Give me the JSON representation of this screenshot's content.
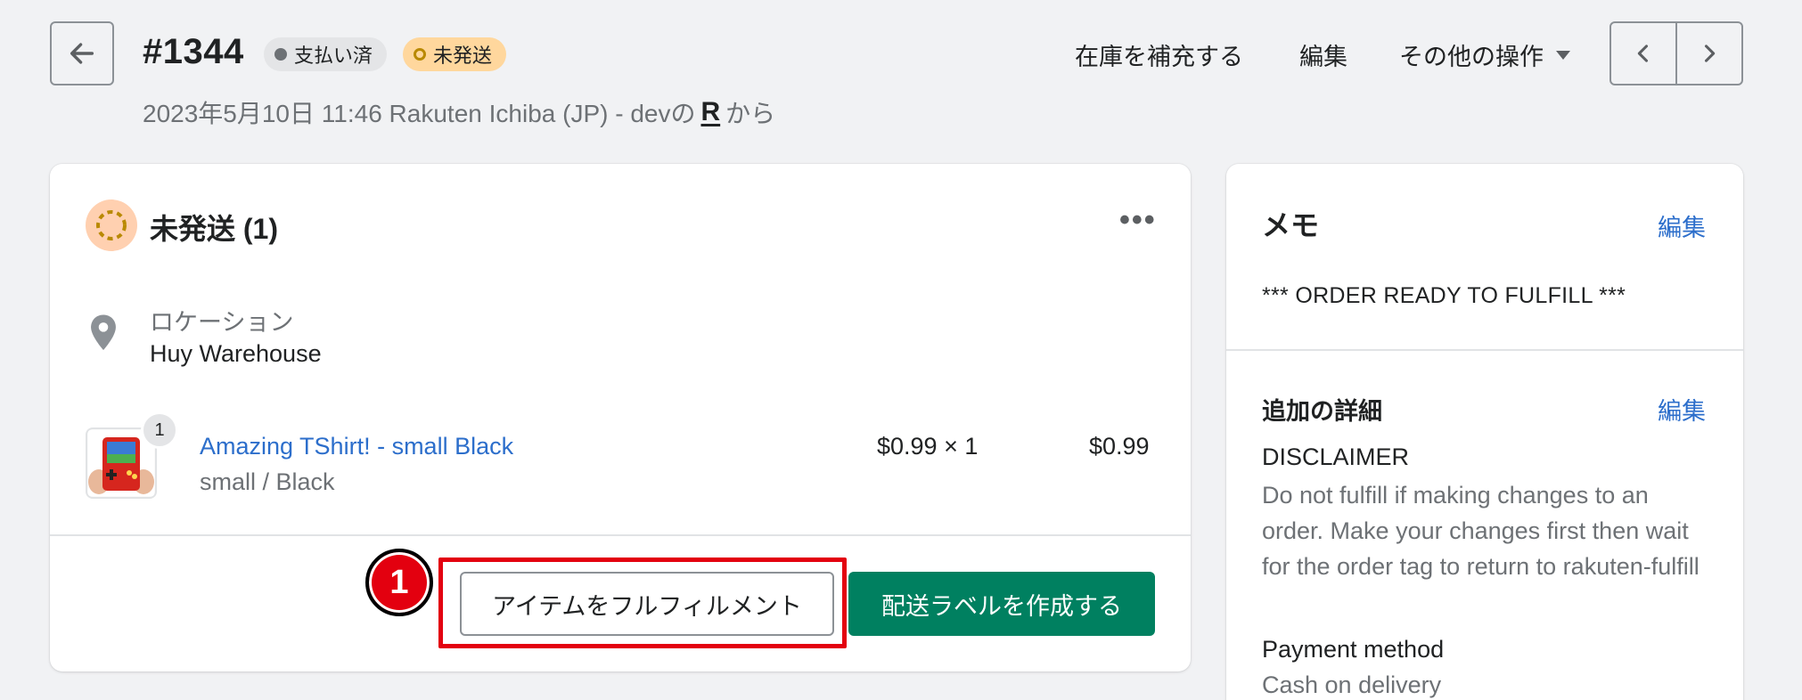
{
  "header": {
    "order_number": "#1344",
    "badges": {
      "paid": "支払い済",
      "unfulfilled": "未発送"
    },
    "subtitle_prefix": "2023年5月10日 11:46 Rakuten Ichiba (JP) - devの",
    "source_logo": "R",
    "subtitle_suffix": "から",
    "actions": {
      "restock": "在庫を補充する",
      "edit": "編集",
      "more": "その他の操作"
    }
  },
  "fulfillment_card": {
    "title": "未発送 (1)",
    "location_label": "ロケーション",
    "location_value": "Huy Warehouse",
    "item": {
      "quantity": "1",
      "name": "Amazing TShirt! - small Black",
      "variant": "small / Black",
      "price_qty": "$0.99 × 1",
      "total": "$0.99"
    },
    "buttons": {
      "fulfill": "アイテムをフルフィルメント",
      "create_label": "配送ラベルを作成する"
    },
    "step_marker": "1"
  },
  "sidebar": {
    "memo": {
      "title": "メモ",
      "edit": "編集",
      "text": "*** ORDER READY TO FULFILL ***"
    },
    "details": {
      "title": "追加の詳細",
      "edit": "編集",
      "disclaimer_label": "DISCLAIMER",
      "disclaimer_text": "Do not fulfill if making changes to an order. Make your changes first then wait for the order tag to return to rakuten-fulfill",
      "payment_label": "Payment method",
      "payment_value": "Cash on delivery"
    }
  },
  "colors": {
    "accent_green": "#008060",
    "link_blue": "#2c6ecb",
    "highlight_red": "#e3000f",
    "unfulfilled_badge": "#ffd79d"
  },
  "icons": {
    "back": "arrow-left-icon",
    "prev": "chevron-left-icon",
    "next": "chevron-right-icon",
    "more": "horizontal-dots-icon",
    "location": "map-pin-icon",
    "status": "unfulfilled-ring-icon"
  }
}
